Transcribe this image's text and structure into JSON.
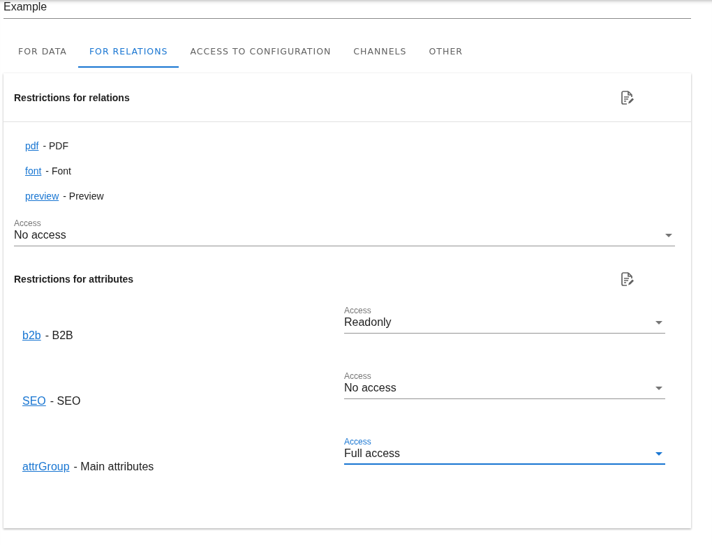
{
  "name_field": {
    "value": "Example"
  },
  "tabs": [
    {
      "label": "FOR DATA",
      "selected": false
    },
    {
      "label": "FOR RELATIONS",
      "selected": true
    },
    {
      "label": "ACCESS TO CONFIGURATION",
      "selected": false
    },
    {
      "label": "CHANNELS",
      "selected": false
    },
    {
      "label": "OTHER",
      "selected": false
    }
  ],
  "relations": {
    "title": "Restrictions for relations",
    "items": [
      {
        "link": "pdf",
        "text": "- PDF"
      },
      {
        "link": "font",
        "text": "- Font"
      },
      {
        "link": "preview",
        "text": "- Preview"
      }
    ],
    "access": {
      "label": "Access",
      "value": "No access",
      "focused": false
    }
  },
  "attributes": {
    "title": "Restrictions for attributes",
    "items": [
      {
        "link": "b2b",
        "text": "- B2B",
        "access": {
          "label": "Access",
          "value": "Readonly",
          "focused": false
        }
      },
      {
        "link": "SEO",
        "text": "- SEO",
        "access": {
          "label": "Access",
          "value": "No access",
          "focused": false
        }
      },
      {
        "link": "attrGroup",
        "text": "- Main attributes",
        "access": {
          "label": "Access",
          "value": "Full access",
          "focused": true
        }
      }
    ]
  }
}
